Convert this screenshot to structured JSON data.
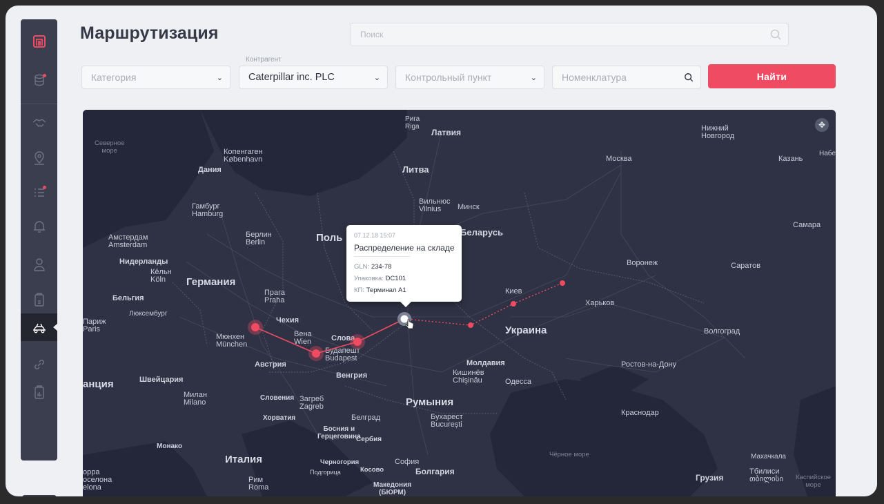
{
  "page": {
    "title": "Маршрутизация"
  },
  "search": {
    "placeholder": "Поиск"
  },
  "filters": {
    "category": {
      "placeholder": "Категория"
    },
    "counterparty": {
      "label": "Контрагент",
      "value": "Caterpillar inc. PLC"
    },
    "checkpoint": {
      "placeholder": "Контрольный пункт"
    },
    "nomenclature": {
      "placeholder": "Номенклатура"
    },
    "find_label": "Найти"
  },
  "sidebar": {
    "items": [
      {
        "icon": "logo-icon"
      },
      {
        "icon": "database-icon",
        "badge": true
      },
      {
        "icon": "handshake-icon"
      },
      {
        "icon": "location-pin-icon"
      },
      {
        "icon": "checklist-icon",
        "badge": true
      },
      {
        "icon": "bell-icon"
      },
      {
        "icon": "user-icon"
      },
      {
        "icon": "document-icon"
      },
      {
        "icon": "routing-icon",
        "active": true
      },
      {
        "icon": "link-icon"
      },
      {
        "icon": "clipboard-chart-icon"
      }
    ]
  },
  "map": {
    "labels": {
      "riga": "Рига",
      "riga_lat": "Riga",
      "latvia": "Латвия",
      "nizhny": "Нижний",
      "novgorod": "Новгород",
      "north_sea1": "Северное",
      "north_sea2": "море",
      "copenhagen": "Копенгаген",
      "kobenhavn": "København",
      "denmark": "Дания",
      "moscow": "Москва",
      "kazan": "Казань",
      "nabe": "Набе",
      "lithuania": "Литва",
      "vilnius": "Вильнюс",
      "vilnius_lat": "Vilnius",
      "minsk": "Минск",
      "hamburg": "Гамбург",
      "hamburg_lat": "Hamburg",
      "belarus": "Беларусь",
      "samara": "Самара",
      "amsterdam": "Амстердам",
      "amsterdam_lat": "Amsterdam",
      "berlin": "Берлин",
      "berlin_lat": "Berlin",
      "poland": "Поль",
      "netherlands": "Нидерланды",
      "voronezh": "Воронеж",
      "saratov": "Саратов",
      "koln": "Кёльн",
      "koln_lat": "Köln",
      "germany": "Германия",
      "kiev": "Киев",
      "belgium": "Бельгия",
      "prague": "Прага",
      "praha": "Praha",
      "kharkov": "Харьков",
      "luxembourg": "Люксембург",
      "paris": "Париж",
      "paris_lat": "Paris",
      "czechia": "Чехия",
      "ukraine": "Украина",
      "volgograd": "Волгоград",
      "munich": "Мюнхен",
      "munchen": "München",
      "vienna": "Вена",
      "wien": "Wien",
      "slovakia": "Слова",
      "budapest": "Будапешт",
      "budapest_lat": "Budapest",
      "austria": "Австрия",
      "moldova": "Молдавия",
      "kishinev": "Кишинёв",
      "chisinau": "Chişinău",
      "odessa": "Одесса",
      "rostov": "Ростов-на-Дону",
      "switzerland": "Швейцария",
      "hungary": "Венгрия",
      "milan": "Милан",
      "milano": "Milano",
      "france_part": "анция",
      "slovenia": "Словения",
      "zagreb": "Загреб",
      "zagreb_lat": "Zagreb",
      "romania": "Румыния",
      "croatia": "Хорватия",
      "belgrade": "Белград",
      "bucharest": "Бухарест",
      "bucuresti": "București",
      "krasnodar": "Краснодар",
      "bosnia1": "Босния и",
      "bosnia2": "Герцеговина",
      "serbia": "Сербия",
      "monaco": "Монако",
      "black_sea": "Чёрное море",
      "makhachkala": "Махачкала",
      "italy": "Италия",
      "montenegro": "Черногория",
      "kosovo": "Косово",
      "sofia": "София",
      "podgorica": "Подгорица",
      "bulgaria": "Болгария",
      "tbilisi": "Тбилиси",
      "tbilisi_geo": "თბილისი",
      "georgia": "Грузия",
      "caspian1": "Каспийское",
      "caspian2": "море",
      "andorra": "орра",
      "barcelona": "оселона",
      "barcelona2": "elona",
      "rome": "Рим",
      "roma": "Roma",
      "macedonia1": "Македония",
      "macedonia2": "(БЮРМ)"
    },
    "move_control": "✥"
  },
  "tooltip": {
    "time": "07.12.18  15:07",
    "title": "Распределение на складе",
    "gln_label": "GLN: ",
    "gln_value": "234-78",
    "pack_label": "Упаковка: ",
    "pack_value": "DC101",
    "kp_label": "КП: ",
    "kp_value": "Терминал А1"
  },
  "colors": {
    "accent": "#ef4b63",
    "sidebar": "#3a3e4e",
    "map_bg": "#2a2d3e"
  }
}
